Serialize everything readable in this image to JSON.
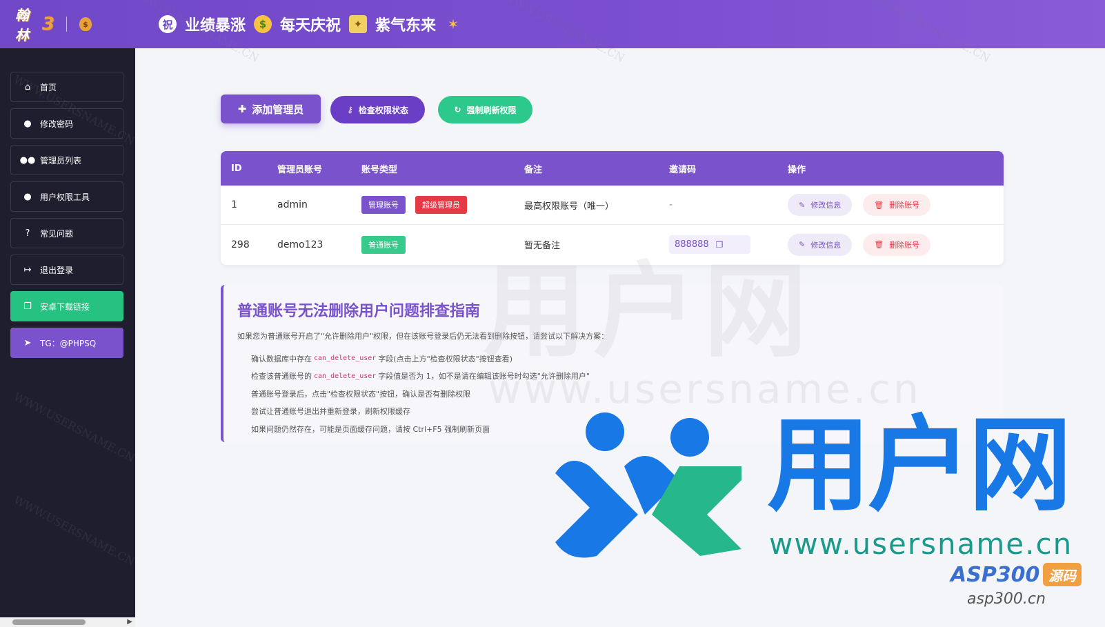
{
  "header": {
    "logo_text": "翰林",
    "logo_num": "3",
    "banner": [
      "业绩暴涨",
      "每天庆祝",
      "紫气东来"
    ]
  },
  "sidebar": {
    "items": [
      {
        "label": "首页",
        "icon": "home-icon"
      },
      {
        "label": "修改密码",
        "icon": "user-edit-icon"
      },
      {
        "label": "管理员列表",
        "icon": "users-icon"
      },
      {
        "label": "用户权限工具",
        "icon": "user-lock-icon"
      },
      {
        "label": "常见问题",
        "icon": "question-icon"
      },
      {
        "label": "退出登录",
        "icon": "logout-icon"
      },
      {
        "label": "安卓下载链接",
        "icon": "copy-icon"
      },
      {
        "label": "TG：@PHPSQ",
        "icon": "telegram-icon"
      }
    ]
  },
  "toolbar": {
    "add_label": "添加管理员",
    "check_label": "检查权限状态",
    "refresh_label": "强制刷新权限"
  },
  "table": {
    "headers": [
      "ID",
      "管理员账号",
      "账号类型",
      "备注",
      "邀请码",
      "操作"
    ],
    "rows": [
      {
        "id": "1",
        "account": "admin",
        "tags": [
          "管理账号",
          "超级管理员"
        ],
        "note": "最高权限账号（唯一）",
        "code": "-",
        "edit": "修改信息",
        "delete": "删除账号"
      },
      {
        "id": "298",
        "account": "demo123",
        "tags": [
          "普通账号"
        ],
        "note": "暂无备注",
        "code": "888888",
        "edit": "修改信息",
        "delete": "删除账号"
      }
    ]
  },
  "guide": {
    "title": "普通账号无法删除用户问题排查指南",
    "intro": "如果您为普通账号开启了\"允许删除用户\"权限，但在该账号登录后仍无法看到删除按钮，请尝试以下解决方案：",
    "step1_a": "确认数据库中存在",
    "step1_code": "can_delete_user",
    "step1_b": "字段(点击上方\"检查权限状态\"按钮查看)",
    "step2_a": "检查该普通账号的",
    "step2_code": "can_delete_user",
    "step2_b": "字段值是否为 1，如不是请在编辑该账号时勾选\"允许删除用户\"",
    "step3": "普通账号登录后，点击\"检查权限状态\"按钮，确认是否有删除权限",
    "step4": "尝试让普通账号退出并重新登录，刷新权限缓存",
    "step5": "如果问题仍然存在，可能是页面缓存问题，请按 Ctrl+F5 强制刷新页面"
  },
  "watermark": {
    "diag": "WWW.USERSNAME.CN",
    "logo_text": "用户网",
    "logo_url": "www.usersname.cn",
    "asp_logo": "ASP300",
    "asp_badge": "源码",
    "asp_url": "asp300.cn"
  },
  "colors": {
    "primary": "#7a52cc",
    "success": "#26c281",
    "danger": "#e63946",
    "sidebar_bg": "#1f1e2e"
  }
}
